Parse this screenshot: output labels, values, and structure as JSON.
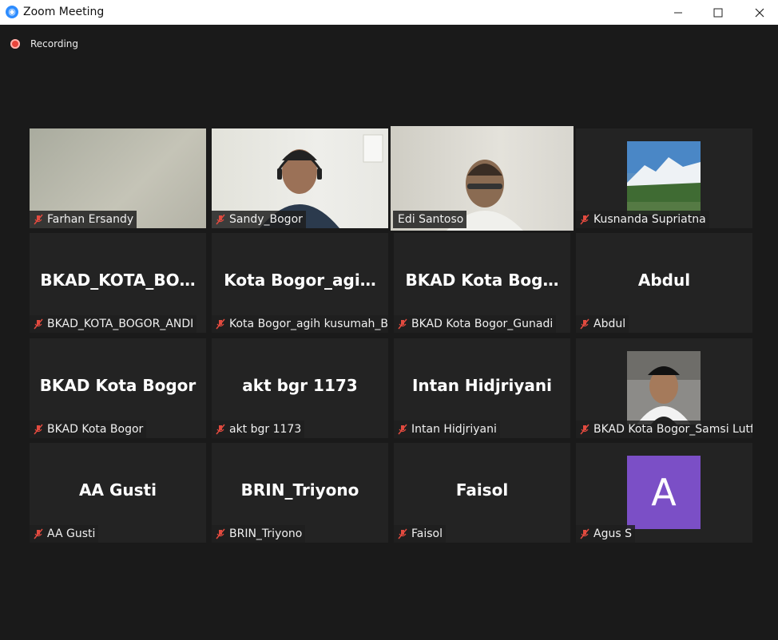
{
  "window": {
    "title": "Zoom Meeting",
    "app_icon": "zoom-icon"
  },
  "recording": {
    "label": "Recording",
    "color": "#e8443a"
  },
  "active_speaker_color": "#d7eb6d",
  "tiles": [
    {
      "nametag": "Farhan Ersandy",
      "type": "video"
    },
    {
      "nametag": "Sandy_Bogor",
      "type": "video"
    },
    {
      "nametag": "Edi Santoso",
      "type": "video",
      "active_speaker": true
    },
    {
      "nametag": "Kusnanda Supriatna",
      "type": "picture"
    },
    {
      "name": "BKAD_KOTA_BO…",
      "nametag": "BKAD_KOTA_BOGOR_ANDI"
    },
    {
      "name": "Kota Bogor_agi…",
      "nametag": "Kota Bogor_agih kusumah_B…"
    },
    {
      "name": "BKAD Kota Bog…",
      "nametag": "BKAD Kota Bogor_Gunadi"
    },
    {
      "name": "Abdul",
      "nametag": "Abdul"
    },
    {
      "name": "BKAD Kota Bogor",
      "nametag": "BKAD Kota Bogor"
    },
    {
      "name": "akt bgr 1173",
      "nametag": "akt bgr 1173"
    },
    {
      "name": "Intan Hidjriyani",
      "nametag": "Intan Hidjriyani"
    },
    {
      "nametag": "BKAD Kota Bogor_Samsi Lutfi",
      "type": "picture"
    },
    {
      "name": "AA Gusti",
      "nametag": "AA Gusti"
    },
    {
      "name": "BRIN_Triyono",
      "nametag": "BRIN_Triyono"
    },
    {
      "name": "Faisol",
      "nametag": "Faisol"
    },
    {
      "nametag": "Agus S",
      "avatar_letter": "A",
      "avatar_color": "#7b4fc6"
    }
  ]
}
